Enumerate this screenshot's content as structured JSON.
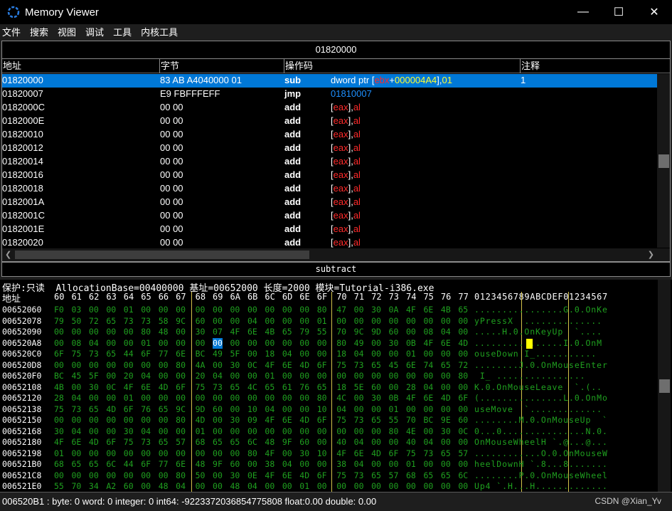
{
  "window": {
    "title": "Memory Viewer",
    "minimize": "—",
    "maximize": "☐",
    "close": "✕"
  },
  "menu": [
    "文件",
    "搜索",
    "视图",
    "调试",
    "工具",
    "内核工具"
  ],
  "disassembler": {
    "address_title": "01820000",
    "columns": [
      "地址",
      "字节",
      "操作码",
      "注释"
    ],
    "rows": [
      {
        "addr": "01820000",
        "bytes": "83 AB A4040000 01",
        "op": "sub",
        "args": [
          {
            "t": "dword ptr ",
            "c": "brk"
          },
          {
            "t": "[",
            "c": "brk"
          },
          {
            "t": "ebx",
            "c": "reg"
          },
          {
            "t": "+",
            "c": "brk"
          },
          {
            "t": "000004A4",
            "c": "hl-num"
          },
          {
            "t": "],",
            "c": "brk"
          },
          {
            "t": "01",
            "c": "hl-num"
          }
        ],
        "comment": "1",
        "selected": true
      },
      {
        "addr": "01820007",
        "bytes": "E9 FBFFFEFF",
        "op": "jmp",
        "args": [
          {
            "t": "01810007",
            "c": "num"
          }
        ],
        "comment": ""
      },
      {
        "addr": "0182000C",
        "bytes": "00 00",
        "op": "add",
        "args": [
          {
            "t": "[",
            "c": "brk"
          },
          {
            "t": "eax",
            "c": "reg"
          },
          {
            "t": "],",
            "c": "brk"
          },
          {
            "t": "al",
            "c": "reg"
          }
        ],
        "comment": ""
      },
      {
        "addr": "0182000E",
        "bytes": "00 00",
        "op": "add",
        "args": [
          {
            "t": "[",
            "c": "brk"
          },
          {
            "t": "eax",
            "c": "reg"
          },
          {
            "t": "],",
            "c": "brk"
          },
          {
            "t": "al",
            "c": "reg"
          }
        ],
        "comment": ""
      },
      {
        "addr": "01820010",
        "bytes": "00 00",
        "op": "add",
        "args": [
          {
            "t": "[",
            "c": "brk"
          },
          {
            "t": "eax",
            "c": "reg"
          },
          {
            "t": "],",
            "c": "brk"
          },
          {
            "t": "al",
            "c": "reg"
          }
        ],
        "comment": ""
      },
      {
        "addr": "01820012",
        "bytes": "00 00",
        "op": "add",
        "args": [
          {
            "t": "[",
            "c": "brk"
          },
          {
            "t": "eax",
            "c": "reg"
          },
          {
            "t": "],",
            "c": "brk"
          },
          {
            "t": "al",
            "c": "reg"
          }
        ],
        "comment": ""
      },
      {
        "addr": "01820014",
        "bytes": "00 00",
        "op": "add",
        "args": [
          {
            "t": "[",
            "c": "brk"
          },
          {
            "t": "eax",
            "c": "reg"
          },
          {
            "t": "],",
            "c": "brk"
          },
          {
            "t": "al",
            "c": "reg"
          }
        ],
        "comment": ""
      },
      {
        "addr": "01820016",
        "bytes": "00 00",
        "op": "add",
        "args": [
          {
            "t": "[",
            "c": "brk"
          },
          {
            "t": "eax",
            "c": "reg"
          },
          {
            "t": "],",
            "c": "brk"
          },
          {
            "t": "al",
            "c": "reg"
          }
        ],
        "comment": ""
      },
      {
        "addr": "01820018",
        "bytes": "00 00",
        "op": "add",
        "args": [
          {
            "t": "[",
            "c": "brk"
          },
          {
            "t": "eax",
            "c": "reg"
          },
          {
            "t": "],",
            "c": "brk"
          },
          {
            "t": "al",
            "c": "reg"
          }
        ],
        "comment": ""
      },
      {
        "addr": "0182001A",
        "bytes": "00 00",
        "op": "add",
        "args": [
          {
            "t": "[",
            "c": "brk"
          },
          {
            "t": "eax",
            "c": "reg"
          },
          {
            "t": "],",
            "c": "brk"
          },
          {
            "t": "al",
            "c": "reg"
          }
        ],
        "comment": ""
      },
      {
        "addr": "0182001C",
        "bytes": "00 00",
        "op": "add",
        "args": [
          {
            "t": "[",
            "c": "brk"
          },
          {
            "t": "eax",
            "c": "reg"
          },
          {
            "t": "],",
            "c": "brk"
          },
          {
            "t": "al",
            "c": "reg"
          }
        ],
        "comment": ""
      },
      {
        "addr": "0182001E",
        "bytes": "00 00",
        "op": "add",
        "args": [
          {
            "t": "[",
            "c": "brk"
          },
          {
            "t": "eax",
            "c": "reg"
          },
          {
            "t": "],",
            "c": "brk"
          },
          {
            "t": "al",
            "c": "reg"
          }
        ],
        "comment": ""
      },
      {
        "addr": "01820020",
        "bytes": "00 00",
        "op": "add",
        "args": [
          {
            "t": "[",
            "c": "brk"
          },
          {
            "t": "eax",
            "c": "reg"
          },
          {
            "t": "],",
            "c": "brk"
          },
          {
            "t": "al",
            "c": "reg"
          }
        ],
        "comment": ""
      }
    ]
  },
  "instruction_help": "subtract",
  "hex": {
    "protection_line": "保护:只读  AllocationBase=00400000 基址=00652000 长度=2000 模块=Tutorial-i386.exe",
    "addr_label": "地址",
    "columns": [
      "60",
      "61",
      "62",
      "63",
      "64",
      "65",
      "66",
      "67",
      "68",
      "69",
      "6A",
      "6B",
      "6C",
      "6D",
      "6E",
      "6F",
      "70",
      "71",
      "72",
      "73",
      "74",
      "75",
      "76",
      "77"
    ],
    "ascii_header": "0123456789ABCDEF01234567",
    "rows": [
      {
        "addr": "00652060",
        "bytes": [
          "F0",
          "03",
          "00",
          "00",
          "01",
          "00",
          "00",
          "00",
          "00",
          "00",
          "00",
          "00",
          "00",
          "00",
          "00",
          "80",
          "47",
          "00",
          "30",
          "0A",
          "4F",
          "6E",
          "4B",
          "65"
        ],
        "ascii": "................G.0.OnKe"
      },
      {
        "addr": "00652078",
        "bytes": [
          "79",
          "50",
          "72",
          "65",
          "73",
          "73",
          "58",
          "9C",
          "60",
          "00",
          "00",
          "04",
          "00",
          "00",
          "00",
          "01",
          "00",
          "00",
          "00",
          "00",
          "00",
          "00",
          "00",
          "00"
        ],
        "ascii": "yPressX  .............."
      },
      {
        "addr": "00652090",
        "bytes": [
          "00",
          "00",
          "00",
          "00",
          "00",
          "80",
          "48",
          "00",
          "30",
          "07",
          "4F",
          "6E",
          "4B",
          "65",
          "79",
          "55",
          "70",
          "9C",
          "9D",
          "60",
          "00",
          "08",
          "04",
          "00"
        ],
        "ascii": ".....H.0.OnKeyUp  `...."
      },
      {
        "addr": "006520A8",
        "bytes": [
          "00",
          "08",
          "04",
          "00",
          "00",
          "01",
          "00",
          "00",
          "00",
          "00",
          "00",
          "00",
          "00",
          "00",
          "00",
          "00",
          "80",
          "49",
          "00",
          "30",
          "0B",
          "4F",
          "6E",
          "4D"
        ],
        "ascii": "................I.0.OnM"
      },
      {
        "addr": "006520C0",
        "bytes": [
          "6F",
          "75",
          "73",
          "65",
          "44",
          "6F",
          "77",
          "6E",
          "BC",
          "49",
          "5F",
          "00",
          "18",
          "04",
          "00",
          "00",
          "18",
          "04",
          "00",
          "00",
          "01",
          "00",
          "00",
          "00"
        ],
        "ascii": "ouseDown I_..........."
      },
      {
        "addr": "006520D8",
        "bytes": [
          "00",
          "00",
          "00",
          "00",
          "00",
          "00",
          "00",
          "80",
          "4A",
          "00",
          "30",
          "0C",
          "4F",
          "6E",
          "4D",
          "6F",
          "75",
          "73",
          "65",
          "45",
          "6E",
          "74",
          "65",
          "72"
        ],
        "ascii": "........J.0.OnMouseEnter"
      },
      {
        "addr": "006520F0",
        "bytes": [
          "BC",
          "45",
          "5F",
          "00",
          "20",
          "04",
          "00",
          "00",
          "20",
          "04",
          "00",
          "00",
          "01",
          "00",
          "00",
          "00",
          "00",
          "00",
          "00",
          "00",
          "00",
          "00",
          "00",
          "80"
        ],
        "ascii": " I_ ................"
      },
      {
        "addr": "00652108",
        "bytes": [
          "4B",
          "00",
          "30",
          "0C",
          "4F",
          "6E",
          "4D",
          "6F",
          "75",
          "73",
          "65",
          "4C",
          "65",
          "61",
          "76",
          "65",
          "18",
          "5E",
          "60",
          "00",
          "28",
          "04",
          "00",
          "00"
        ],
        "ascii": "K.0.OnMouseLeave  `.(.."
      },
      {
        "addr": "00652120",
        "bytes": [
          "28",
          "04",
          "00",
          "00",
          "01",
          "00",
          "00",
          "00",
          "00",
          "00",
          "00",
          "00",
          "00",
          "00",
          "00",
          "80",
          "4C",
          "00",
          "30",
          "0B",
          "4F",
          "6E",
          "4D",
          "6F"
        ],
        "ascii": "(...............L.0.OnMo"
      },
      {
        "addr": "00652138",
        "bytes": [
          "75",
          "73",
          "65",
          "4D",
          "6F",
          "76",
          "65",
          "9C",
          "9D",
          "60",
          "00",
          "10",
          "04",
          "00",
          "00",
          "10",
          "04",
          "00",
          "00",
          "01",
          "00",
          "00",
          "00",
          "00"
        ],
        "ascii": "useMove  `............."
      },
      {
        "addr": "00652150",
        "bytes": [
          "00",
          "00",
          "00",
          "00",
          "00",
          "00",
          "00",
          "80",
          "4D",
          "00",
          "30",
          "09",
          "4F",
          "6E",
          "4D",
          "6F",
          "75",
          "73",
          "65",
          "55",
          "70",
          "BC",
          "9E",
          "60"
        ],
        "ascii": "........M.0.OnMouseUp  `"
      },
      {
        "addr": "00652168",
        "bytes": [
          "30",
          "04",
          "00",
          "00",
          "30",
          "04",
          "00",
          "00",
          "01",
          "00",
          "00",
          "00",
          "00",
          "00",
          "00",
          "00",
          "00",
          "00",
          "00",
          "80",
          "4E",
          "00",
          "30",
          "0C"
        ],
        "ascii": "0...0...............N.0."
      },
      {
        "addr": "00652180",
        "bytes": [
          "4F",
          "6E",
          "4D",
          "6F",
          "75",
          "73",
          "65",
          "57",
          "68",
          "65",
          "65",
          "6C",
          "48",
          "9F",
          "60",
          "00",
          "40",
          "04",
          "00",
          "00",
          "40",
          "04",
          "00",
          "00"
        ],
        "ascii": "OnMouseWheelH `.@...@..."
      },
      {
        "addr": "00652198",
        "bytes": [
          "01",
          "00",
          "00",
          "00",
          "00",
          "00",
          "00",
          "00",
          "00",
          "00",
          "00",
          "80",
          "4F",
          "00",
          "30",
          "10",
          "4F",
          "6E",
          "4D",
          "6F",
          "75",
          "73",
          "65",
          "57"
        ],
        "ascii": "............O.0.OnMouseW"
      },
      {
        "addr": "006521B0",
        "bytes": [
          "68",
          "65",
          "65",
          "6C",
          "44",
          "6F",
          "77",
          "6E",
          "48",
          "9F",
          "60",
          "00",
          "38",
          "04",
          "00",
          "00",
          "38",
          "04",
          "00",
          "00",
          "01",
          "00",
          "00",
          "00"
        ],
        "ascii": "heelDownH `.8...8......."
      },
      {
        "addr": "006521C8",
        "bytes": [
          "00",
          "00",
          "00",
          "00",
          "00",
          "00",
          "00",
          "80",
          "50",
          "00",
          "30",
          "0E",
          "4F",
          "6E",
          "4D",
          "6F",
          "75",
          "73",
          "65",
          "57",
          "68",
          "65",
          "65",
          "6C"
        ],
        "ascii": "........P.0.OnMouseWheel"
      },
      {
        "addr": "006521E0",
        "bytes": [
          "55",
          "70",
          "34",
          "A2",
          "60",
          "00",
          "48",
          "04",
          "00",
          "00",
          "48",
          "04",
          "00",
          "00",
          "01",
          "00",
          "00",
          "00",
          "00",
          "00",
          "00",
          "00",
          "00",
          "00"
        ],
        "ascii": "Up4 `.H...H............."
      }
    ]
  },
  "status": "006520B1 : byte: 0 word: 0 integer: 0 int64: -9223372036854775808 float:0.00 double: 0.00",
  "watermark": "CSDN @Xian_Yv",
  "colors": {
    "accent": "#0078d7",
    "register": "#ff2a2a",
    "hex_bytes": "#1fa01f",
    "address_num": "#1e90ff",
    "immediate": "#ffff33"
  }
}
